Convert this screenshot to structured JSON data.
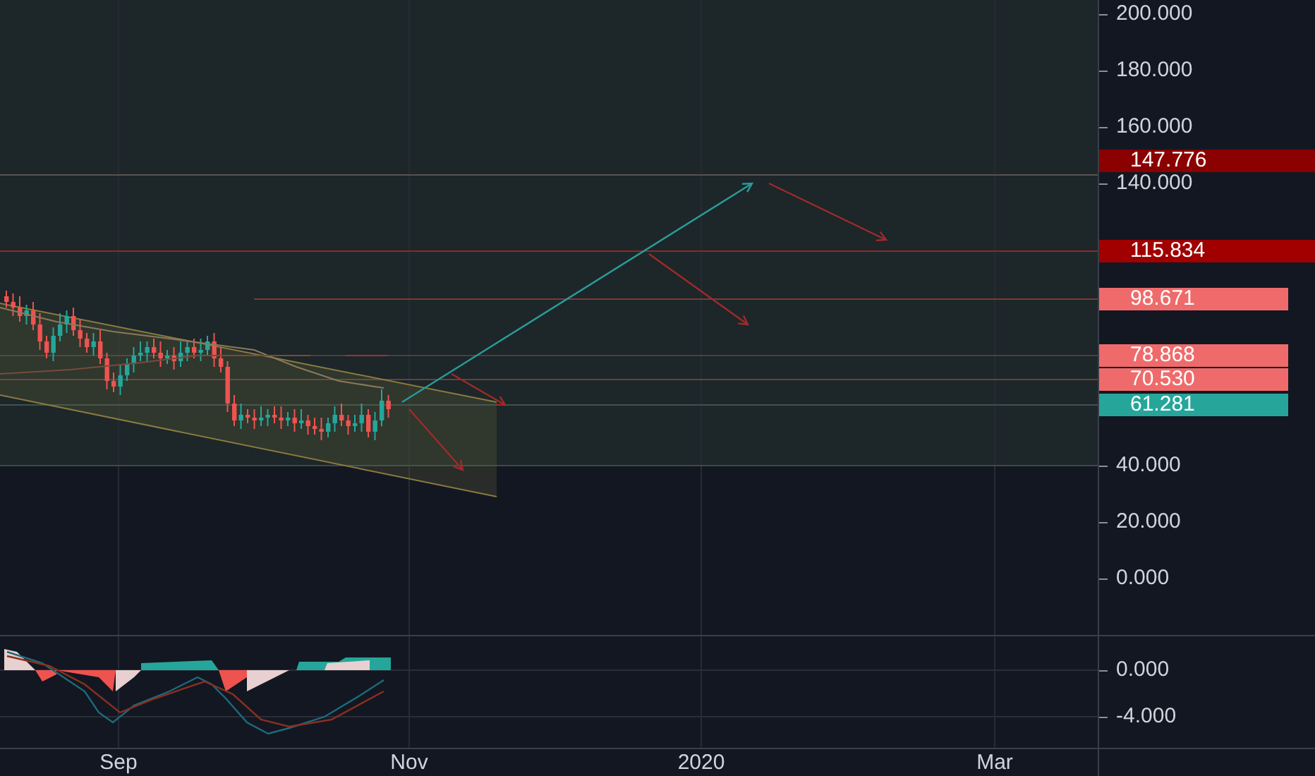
{
  "price_axis": {
    "ticks": [
      "200.000",
      "180.000",
      "160.000",
      "140.000",
      "40.000",
      "20.000",
      "0.000"
    ],
    "badges": [
      {
        "label": "147.776",
        "color": "#8b0000"
      },
      {
        "label": "115.834",
        "color": "#a00000"
      },
      {
        "label": "98.671",
        "color": "#ef6b6b"
      },
      {
        "label": "78.868",
        "color": "#ef6b6b"
      },
      {
        "label": "70.530",
        "color": "#ef6b6b"
      },
      {
        "label": "61.281",
        "color": "#26a69a"
      }
    ]
  },
  "macd_axis": {
    "ticks": [
      "0.000",
      "-4.000"
    ]
  },
  "time_axis": {
    "labels": [
      "Sep",
      "Nov",
      "2020",
      "Mar"
    ]
  }
}
